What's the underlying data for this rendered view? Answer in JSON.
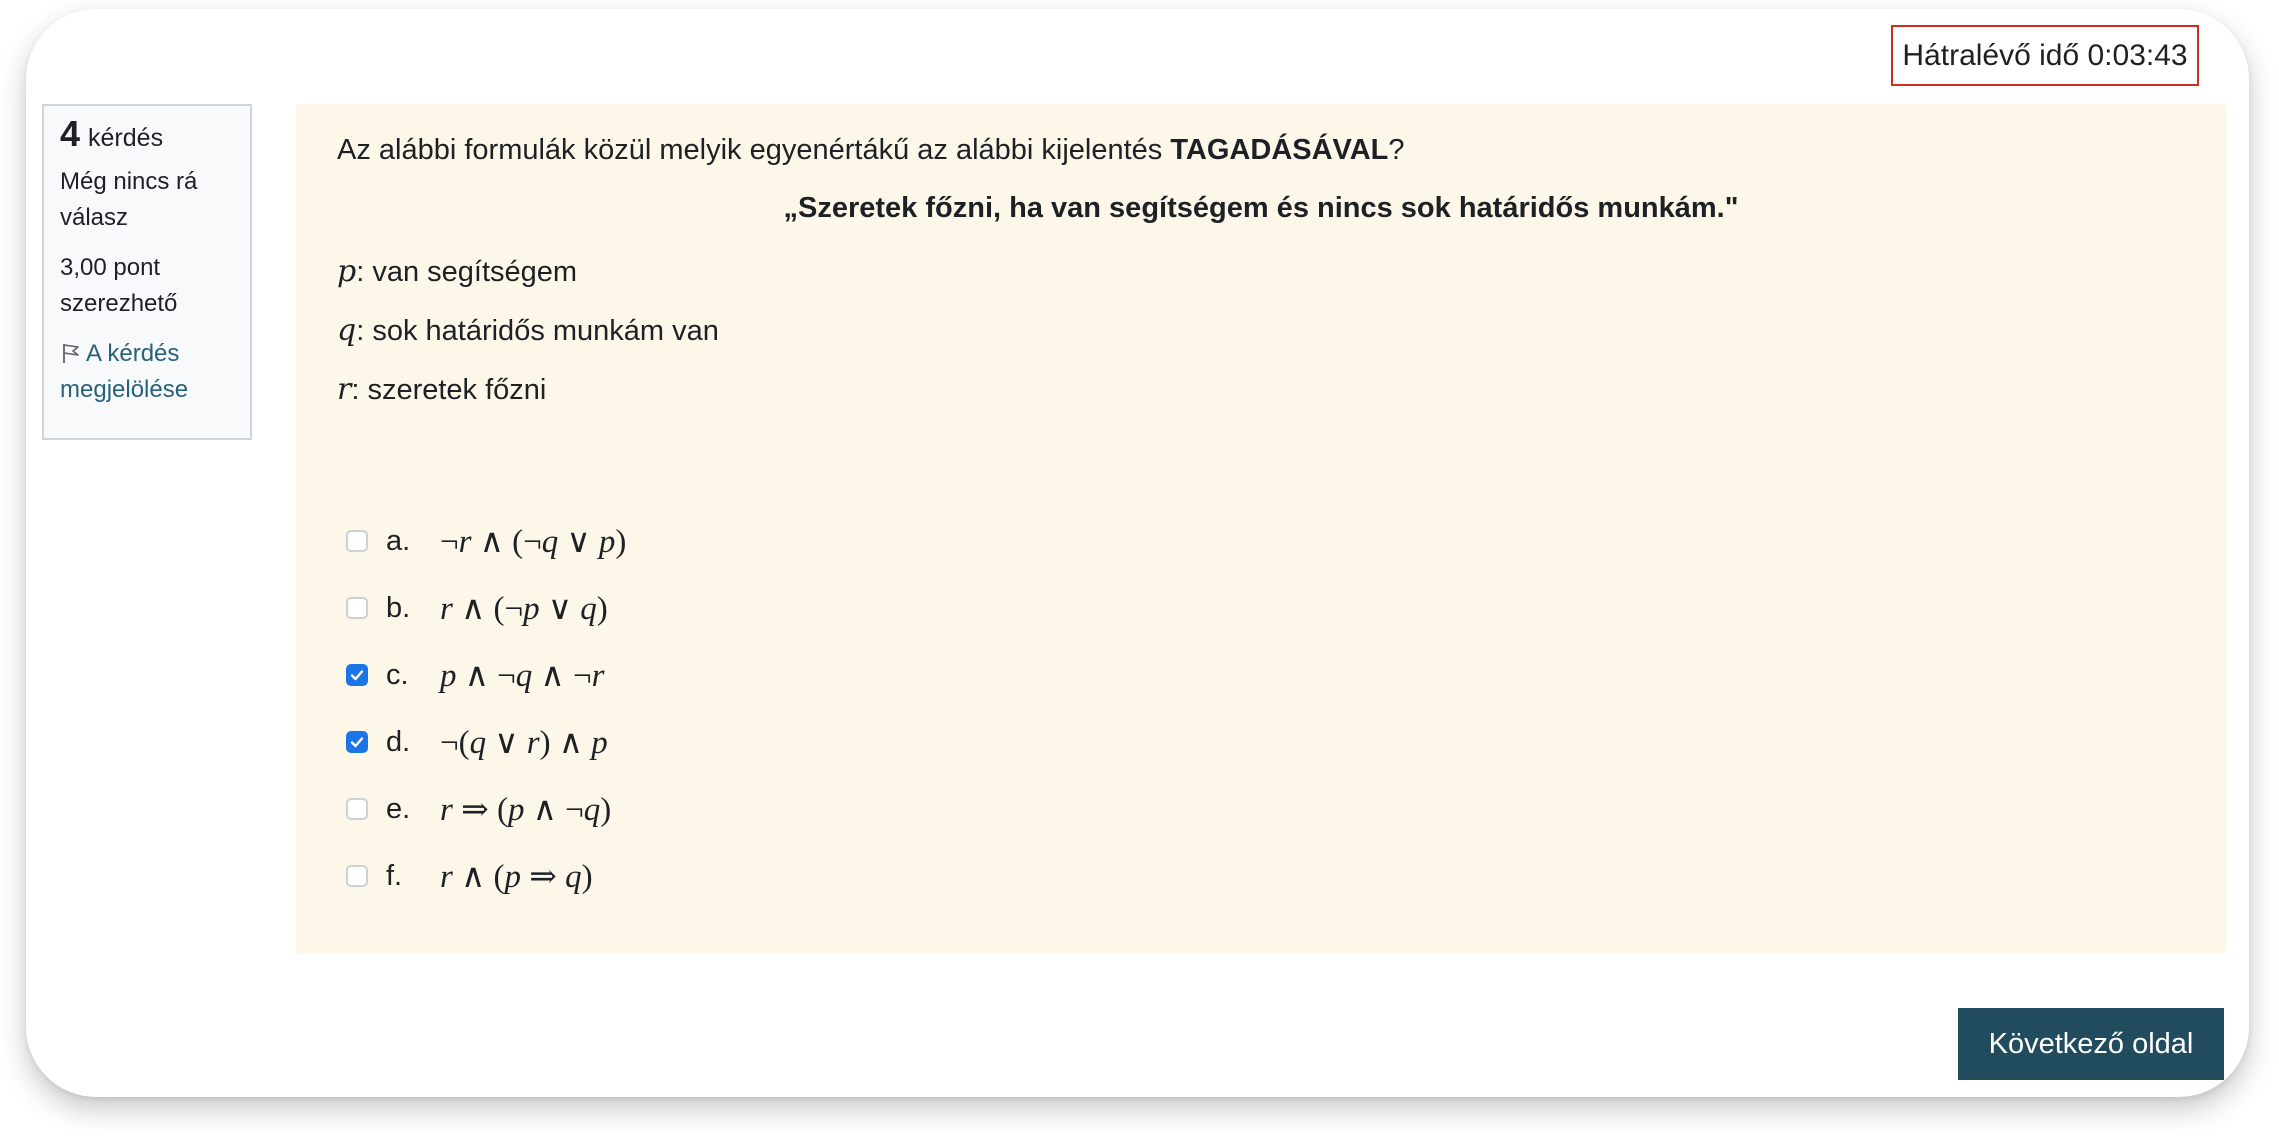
{
  "timer": {
    "label": "Hátralévő idő 0:03:43"
  },
  "info": {
    "question_number": "4",
    "question_word": "kérdés",
    "state": "Még nincs rá válasz",
    "grade": "3,00 pont szerezhető",
    "flag_label": "A kérdés megjelölése"
  },
  "question": {
    "text_before": "Az alábbi formulák közül melyik egyenértákű az alábbi kijelentés ",
    "text_bold": "TAGADÁSÁVAL",
    "text_after": "?",
    "quote": "„Szeretek főzni, ha van segítségem és nincs sok határidős munkám.\"",
    "definitions": [
      {
        "var": "p",
        "text": ": van segítségem"
      },
      {
        "var": "q",
        "text": ": sok határidős munkám van"
      },
      {
        "var": "r",
        "text": ": szeretek főzni"
      }
    ]
  },
  "answers": [
    {
      "letter": "a.",
      "formula": "¬r ∧ (¬q ∨ p)",
      "checked": false
    },
    {
      "letter": "b.",
      "formula": "r ∧ (¬p ∨ q)",
      "checked": false
    },
    {
      "letter": "c.",
      "formula": "p ∧ ¬q ∧ ¬r",
      "checked": true
    },
    {
      "letter": "d.",
      "formula": "¬(q ∨ r) ∧ p",
      "checked": true
    },
    {
      "letter": "e.",
      "formula": "r ⇒ (p ∧ ¬q)",
      "checked": false
    },
    {
      "letter": "f.",
      "formula": "r ∧ (p ⇒ q)",
      "checked": false
    }
  ],
  "next_button": {
    "label": "Következő oldal"
  },
  "colors": {
    "accent": "#204c5e",
    "checkbox_checked": "#1c75e6",
    "timer_border": "#ca3120",
    "content_bg": "#fcf7e8",
    "flag_link": "#27627a"
  }
}
